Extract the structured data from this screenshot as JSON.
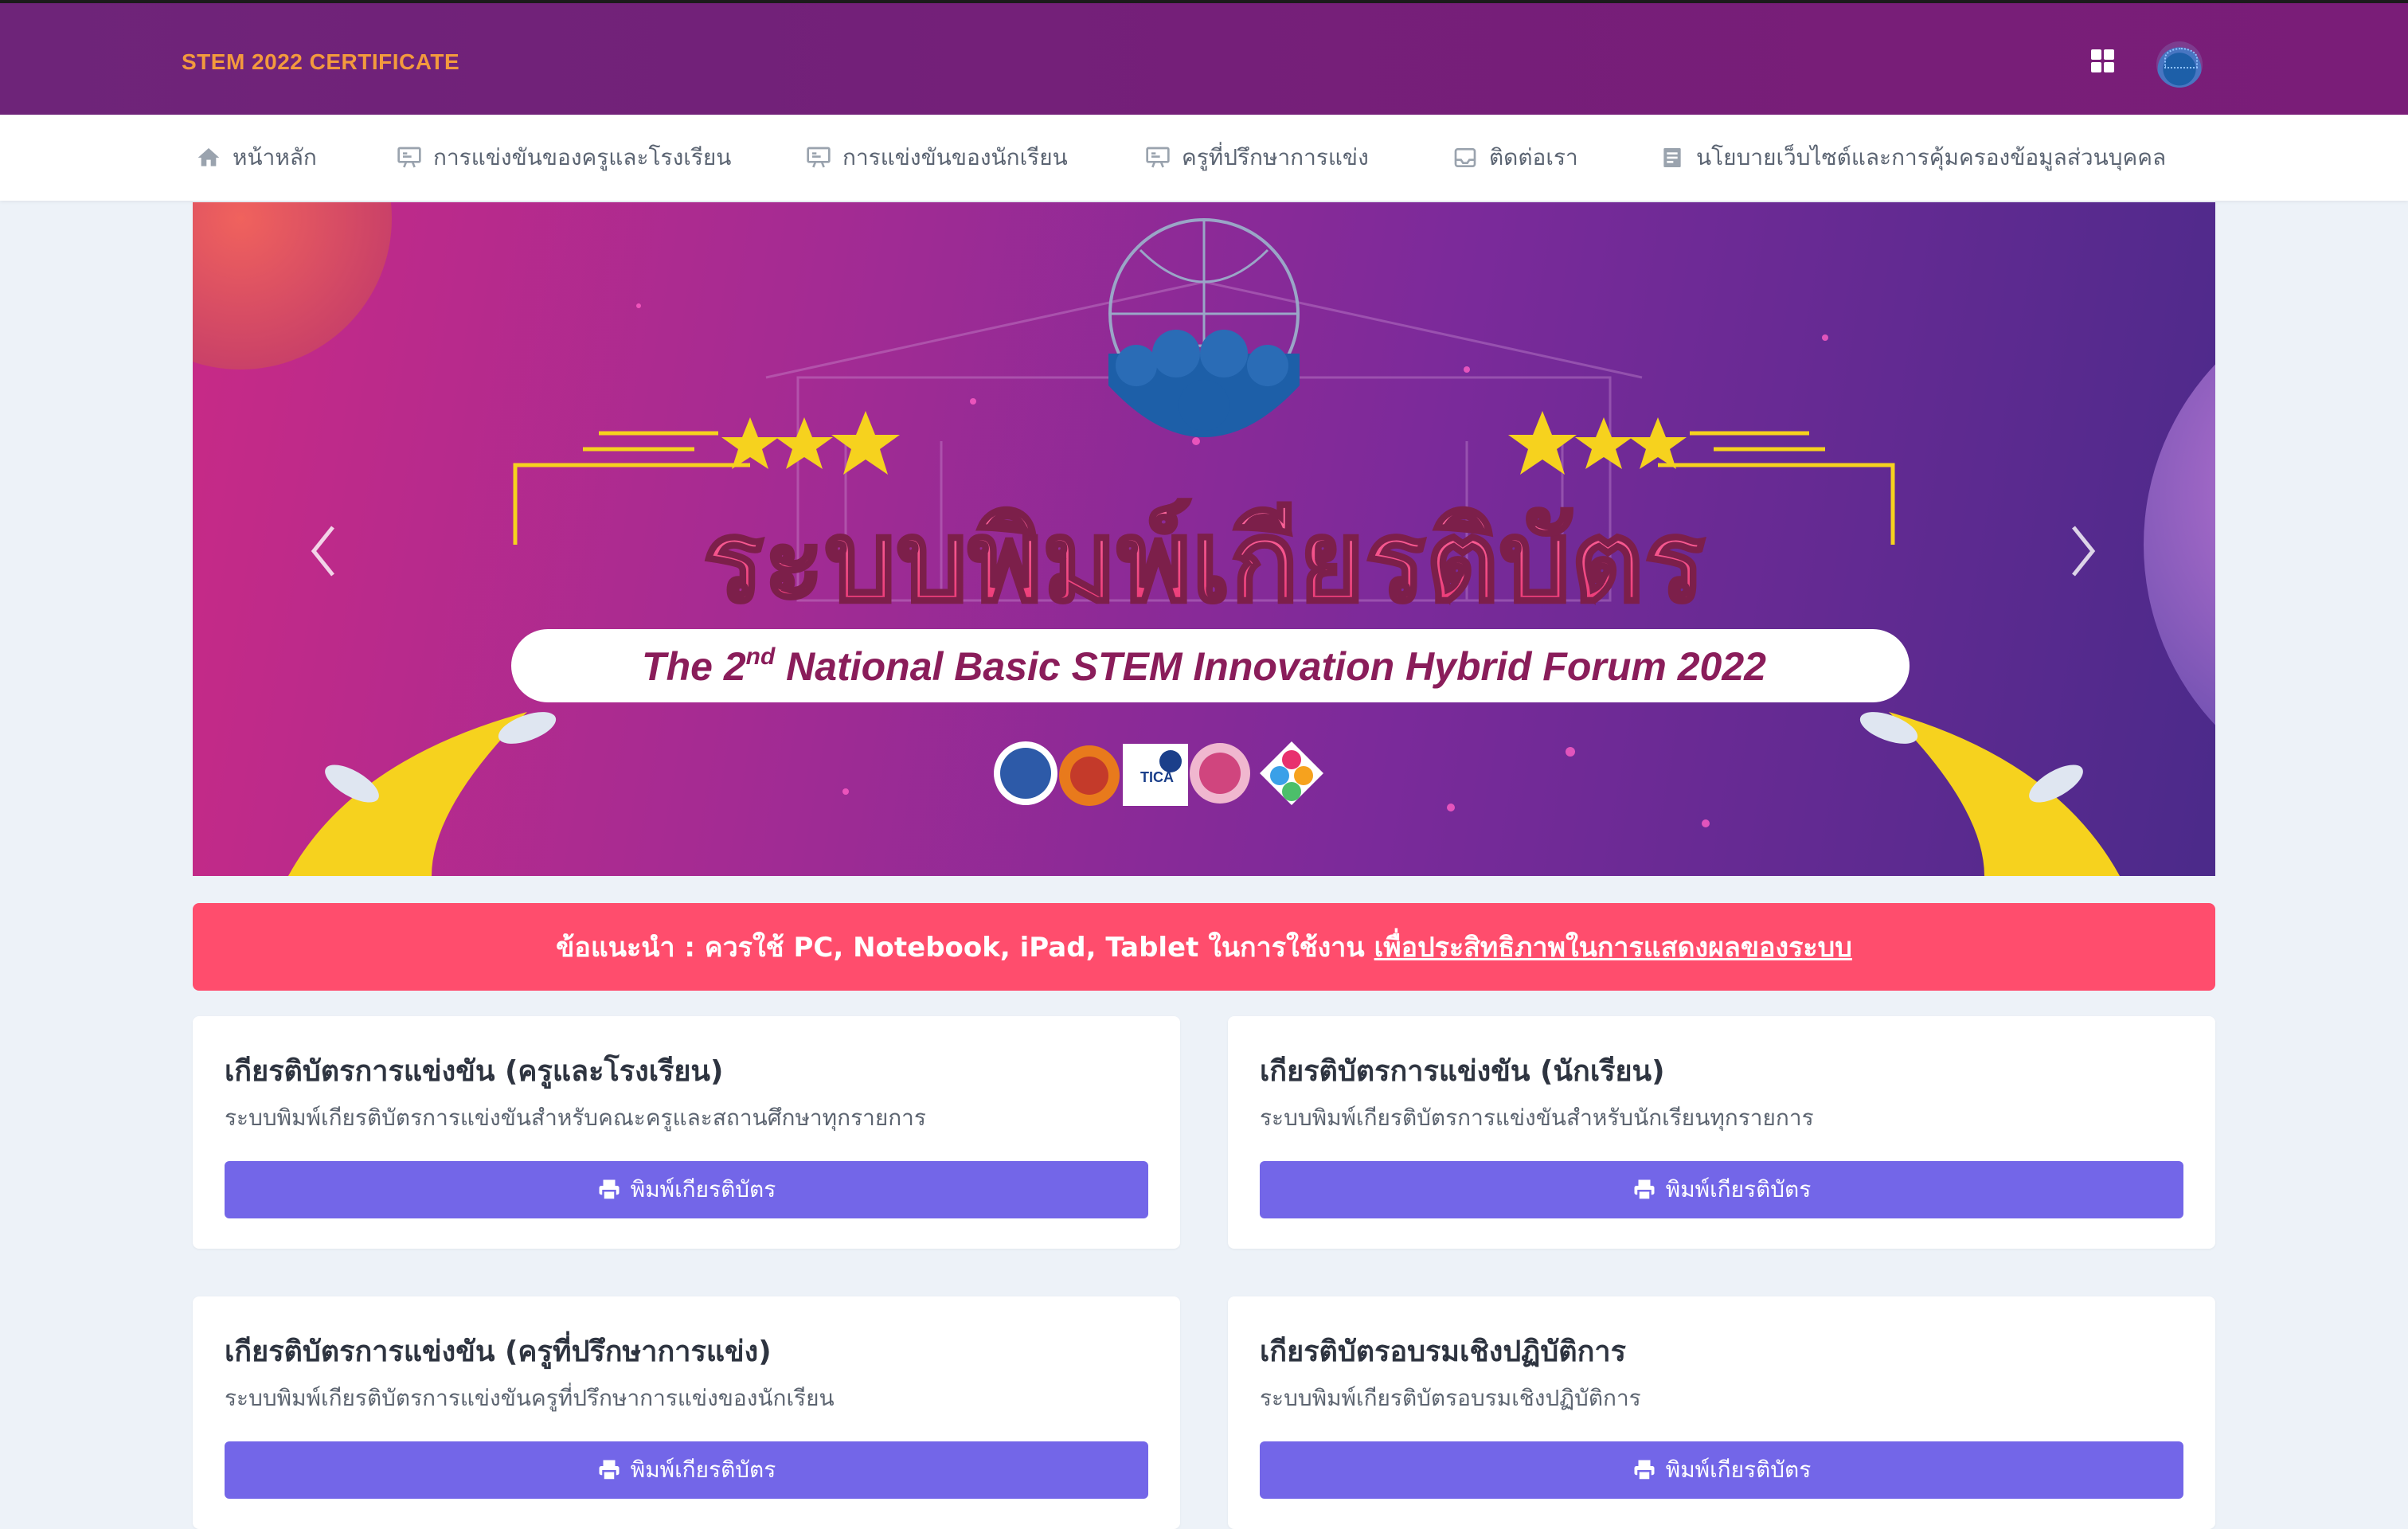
{
  "header": {
    "brand": "STEM 2022 CERTIFICATE",
    "apps_icon": "grid-icon",
    "avatar_icon": "stem-logo-avatar"
  },
  "nav": {
    "items": [
      {
        "label": "หน้าหลัก",
        "icon": "home-icon"
      },
      {
        "label": "การแข่งขันของครูและโรงเรียน",
        "icon": "presentation-icon"
      },
      {
        "label": "การแข่งขันของนักเรียน",
        "icon": "presentation-icon"
      },
      {
        "label": "ครูที่ปรึกษาการแข่ง",
        "icon": "presentation-icon"
      },
      {
        "label": "ติดต่อเรา",
        "icon": "inbox-icon"
      },
      {
        "label": "นโยบายเว็บไซต์และการคุ้มครองข้อมูลส่วนบุคคล",
        "icon": "document-icon"
      }
    ]
  },
  "banner": {
    "headline": "ระบบพิมพ์เกียรติบัตร",
    "subtitle_prefix": "The 2",
    "subtitle_sup": "nd",
    "subtitle_rest": " National Basic STEM Innovation Hybrid Forum 2022",
    "logo_tica": "TICA",
    "colors": {
      "accent": "#f6d21e",
      "headline": "#ff4f86"
    }
  },
  "alert": {
    "text": "ข้อแนะนำ : ควรใช้ PC, Notebook, iPad, Tablet ในการใช้งาน",
    "link": "เพื่อประสิทธิภาพในการแสดงผลของระบบ"
  },
  "cards": [
    {
      "title": "เกียรติบัตรการแข่งขัน (ครูและโรงเรียน)",
      "desc": "ระบบพิมพ์เกียรติบัตรการแข่งขันสำหรับคณะครูและสถานศึกษาทุกรายการ",
      "button": "พิมพ์เกียรติบัตร"
    },
    {
      "title": "เกียรติบัตรการแข่งขัน (นักเรียน)",
      "desc": "ระบบพิมพ์เกียรติบัตรการแข่งขันสำหรับนักเรียนทุกรายการ",
      "button": "พิมพ์เกียรติบัตร"
    },
    {
      "title": "เกียรติบัตรการแข่งขัน (ครูที่ปรึกษาการแข่ง)",
      "desc": "ระบบพิมพ์เกียรติบัตรการแข่งขันครูที่ปรึกษาการแข่งของนักเรียน",
      "button": "พิมพ์เกียรติบัตร"
    },
    {
      "title": "เกียรติบัตรอบรมเชิงปฏิบัติการ",
      "desc": "ระบบพิมพ์เกียรติบัตรอบรมเชิงปฏิบัติการ",
      "button": "พิมพ์เกียรติบัตร"
    }
  ]
}
